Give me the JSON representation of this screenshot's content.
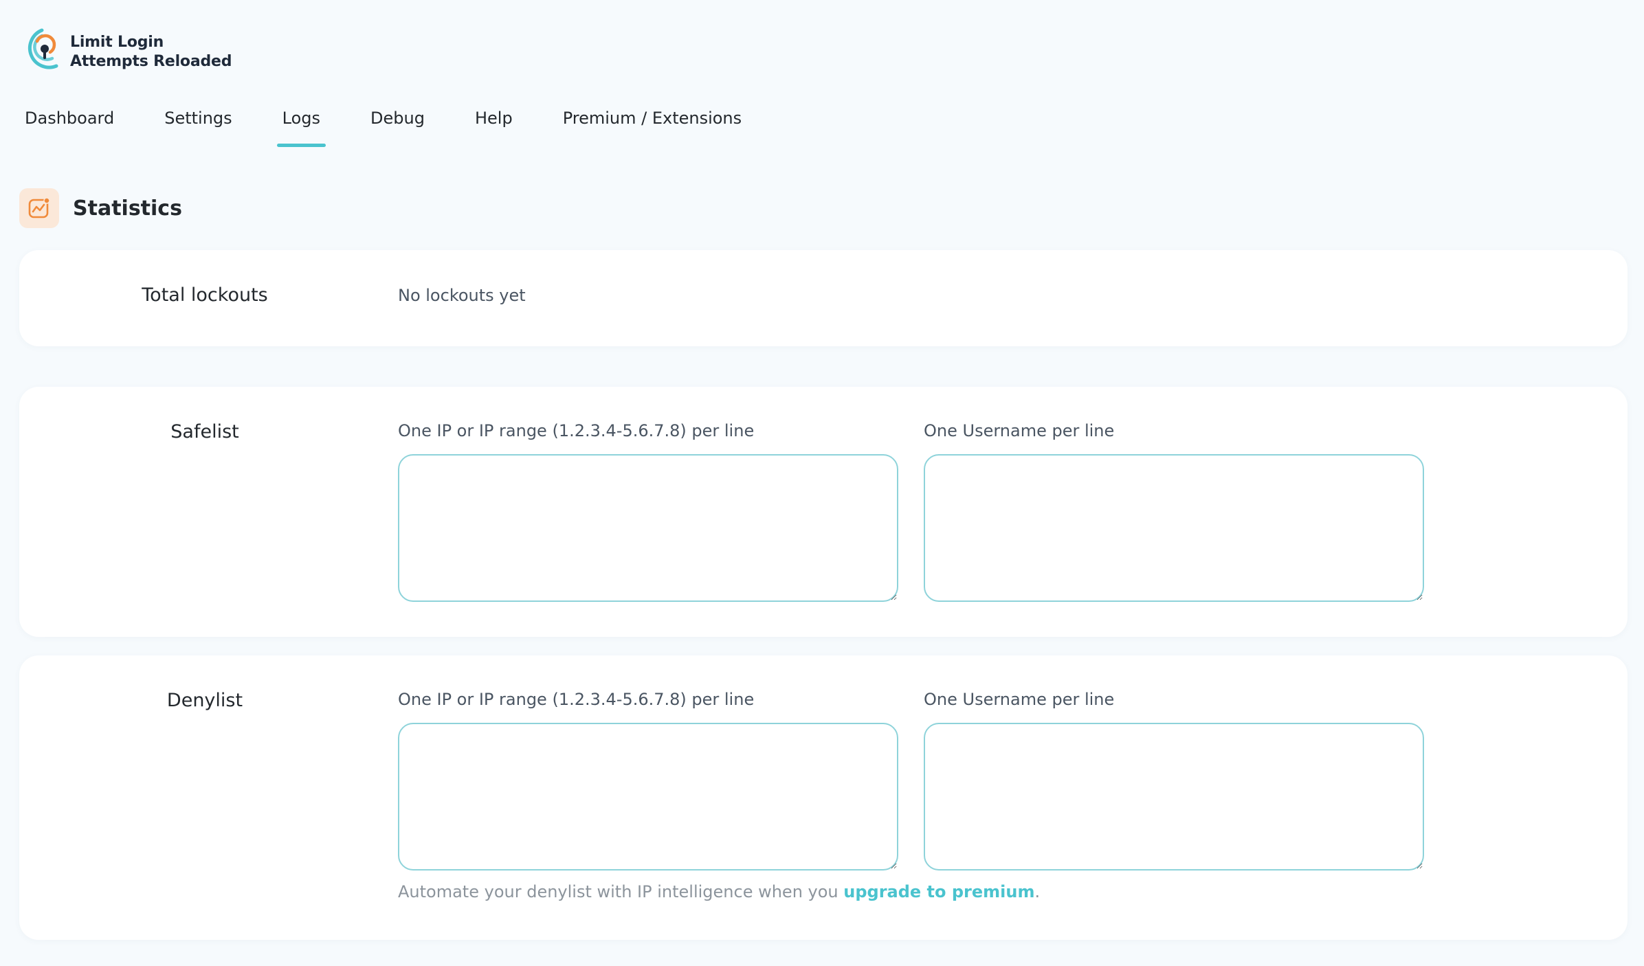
{
  "app": {
    "logo_line1": "Limit Login",
    "logo_line2": "Attempts Reloaded",
    "logo_icon": "keyhole-shield-logo-icon"
  },
  "tabs": [
    {
      "label": "Dashboard",
      "active": false
    },
    {
      "label": "Settings",
      "active": false
    },
    {
      "label": "Logs",
      "active": true
    },
    {
      "label": "Debug",
      "active": false
    },
    {
      "label": "Help",
      "active": false
    },
    {
      "label": "Premium / Extensions",
      "active": false
    }
  ],
  "section": {
    "title": "Statistics",
    "icon": "chart-line-icon"
  },
  "stats": {
    "label": "Total lockouts",
    "value": "No lockouts yet"
  },
  "safelist": {
    "label": "Safelist",
    "ip_label": "One IP or IP range (1.2.3.4-5.6.7.8) per line",
    "ip_value": "",
    "user_label": "One Username per line",
    "user_value": ""
  },
  "denylist": {
    "label": "Denylist",
    "ip_label": "One IP or IP range (1.2.3.4-5.6.7.8) per line",
    "ip_value": "",
    "user_label": "One Username per line",
    "user_value": "",
    "note_prefix": "Automate your denylist with IP intelligence when you ",
    "note_link": "upgrade to premium",
    "note_suffix": "."
  },
  "colors": {
    "accent": "#4ac3ce",
    "logo_orange": "#f08a3a",
    "background": "#f6fafd",
    "card": "#ffffff"
  }
}
